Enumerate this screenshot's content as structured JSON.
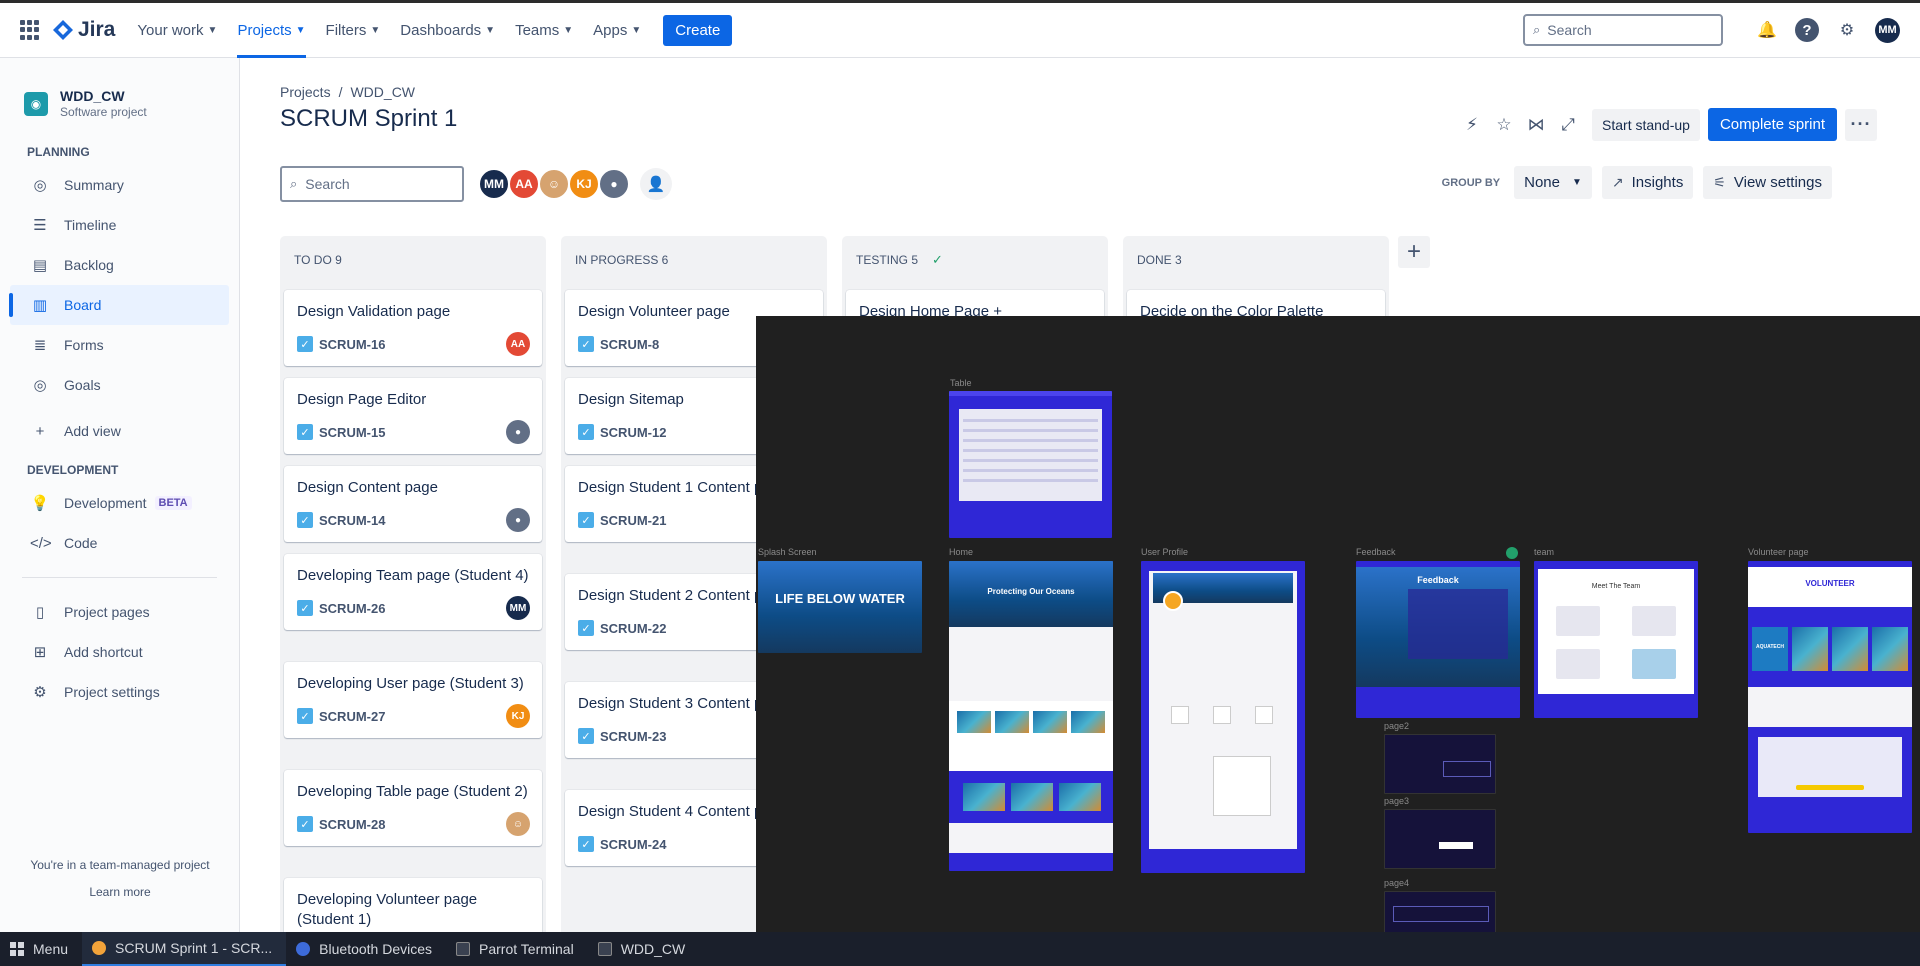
{
  "topnav": {
    "logo": "Jira",
    "items": [
      {
        "label": "Your work"
      },
      {
        "label": "Projects"
      },
      {
        "label": "Filters"
      },
      {
        "label": "Dashboards"
      },
      {
        "label": "Teams"
      },
      {
        "label": "Apps"
      }
    ],
    "create_label": "Create",
    "search_placeholder": "Search",
    "user_initials": "MM",
    "accent_color": "#0c66e4"
  },
  "sidebar": {
    "project_name": "WDD_CW",
    "project_type": "Software project",
    "planning_title": "PLANNING",
    "planning_items": [
      {
        "label": "Summary",
        "icon": "globe-icon"
      },
      {
        "label": "Timeline",
        "icon": "timeline-icon"
      },
      {
        "label": "Backlog",
        "icon": "backlog-icon"
      },
      {
        "label": "Board",
        "icon": "board-icon"
      },
      {
        "label": "Forms",
        "icon": "forms-icon"
      },
      {
        "label": "Goals",
        "icon": "goals-icon"
      }
    ],
    "add_view": "Add view",
    "development_title": "DEVELOPMENT",
    "development_items": [
      {
        "label": "Development",
        "badge": "BETA",
        "icon": "lightbulb-icon"
      },
      {
        "label": "Code",
        "icon": "code-icon"
      }
    ],
    "bottom_items": [
      {
        "label": "Project pages",
        "icon": "pages-icon"
      },
      {
        "label": "Add shortcut",
        "icon": "shortcut-icon"
      },
      {
        "label": "Project settings",
        "icon": "gear-icon"
      }
    ],
    "footer_text": "You're in a team-managed project",
    "footer_link": "Learn more"
  },
  "header": {
    "breadcrumb_root": "Projects",
    "breadcrumb_sep": "/",
    "breadcrumb_project": "WDD_CW",
    "title": "SCRUM Sprint 1",
    "standup_label": "Start stand-up",
    "complete_label": "Complete sprint"
  },
  "filters": {
    "search_placeholder": "Search",
    "avatars": [
      "MM",
      "AA",
      "",
      "KJ",
      ""
    ],
    "group_by_label": "GROUP BY",
    "group_by_value": "None",
    "insights_label": "Insights",
    "view_settings_label": "View settings"
  },
  "columns": [
    {
      "title": "TO DO 9",
      "cards": [
        {
          "title": "Design Validation page",
          "key": "SCRUM-16",
          "assignee": "AA"
        },
        {
          "title": "Design Page Editor",
          "key": "SCRUM-15",
          "assignee": ""
        },
        {
          "title": "Design Content page",
          "key": "SCRUM-14",
          "assignee": ""
        },
        {
          "title": "Developing Team page (Student 4)",
          "key": "SCRUM-26",
          "assignee": "MM"
        },
        {
          "title": "Developing User page (Student 3)",
          "key": "SCRUM-27",
          "assignee": "KJ"
        },
        {
          "title": "Developing Table page (Student 2)",
          "key": "SCRUM-28",
          "assignee": ""
        },
        {
          "title": "Developing Volunteer page (Student 1)",
          "key": "",
          "assignee": ""
        }
      ]
    },
    {
      "title": "IN PROGRESS 6",
      "cards": [
        {
          "title": "Design Volunteer page",
          "key": "SCRUM-8"
        },
        {
          "title": "Design Sitemap",
          "key": "SCRUM-12"
        },
        {
          "title": "Design Student 1 Content page",
          "key": "SCRUM-21"
        },
        {
          "title": "Design Student 2 Content page",
          "key": "SCRUM-22"
        },
        {
          "title": "Design Student 3 Content page",
          "key": "SCRUM-23"
        },
        {
          "title": "Design Student 4 Content page",
          "key": "SCRUM-24"
        }
      ]
    },
    {
      "title": "TESTING 5",
      "cards": [
        {
          "title": "Design Home Page +",
          "key": ""
        }
      ]
    },
    {
      "title": "DONE 3",
      "cards": [
        {
          "title": "Decide on the Color Palette",
          "key": ""
        }
      ]
    }
  ],
  "overlay": {
    "labels": {
      "table": "Table",
      "splash": "Splash Screen",
      "home": "Home",
      "profile": "User Profile",
      "feedback": "Feedback",
      "team": "team",
      "volunteer": "Volunteer page",
      "page2": "page2",
      "page3": "page3",
      "page4": "page4"
    },
    "splash_text": "LIFE BELOW WATER",
    "home_heading": "Protecting Our Oceans",
    "feedback_heading": "Feedback",
    "team_heading": "Meet The Team",
    "volunteer_heading": "VOLUNTEER",
    "aquatech": "AQUATECH"
  },
  "taskbar": {
    "menu": "Menu",
    "items": [
      {
        "label": "SCRUM Sprint 1 - SCR..."
      },
      {
        "label": "Bluetooth Devices"
      },
      {
        "label": "Parrot Terminal"
      },
      {
        "label": "WDD_CW"
      }
    ]
  }
}
